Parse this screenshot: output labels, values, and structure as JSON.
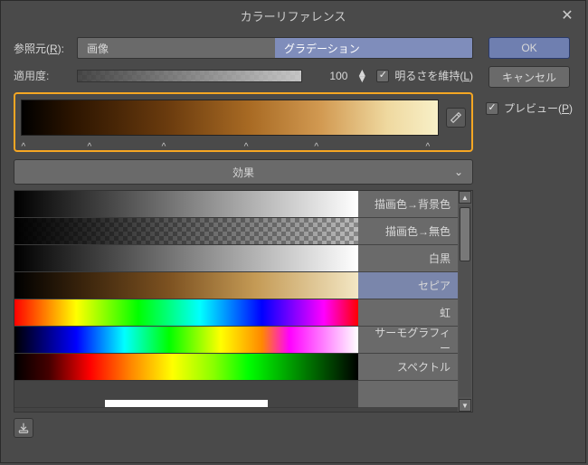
{
  "title": "カラーリファレンス",
  "labels": {
    "source": "参照元(R):",
    "source_u": "R",
    "apply": "適用度:",
    "brightness": "明るさを維持(L)",
    "brightness_u": "L",
    "preview": "プレビュー(P)",
    "preview_u": "P"
  },
  "source_tabs": {
    "image": "画像",
    "gradient": "グラデーション"
  },
  "apply_value": "100",
  "buttons": {
    "ok": "OK",
    "cancel": "キャンセル"
  },
  "effect_label": "効果",
  "presets": [
    {
      "name": "描画色→背景色",
      "gradient": "linear-gradient(to right,#000,#fff)"
    },
    {
      "name": "描画色→無色",
      "gradient": "linear-gradient(to right,#000,rgba(0,0,0,0)),repeating-conic-gradient(#bbb 0% 25%, #888 0% 50%) 0 0/10px 10px"
    },
    {
      "name": "白黒",
      "gradient": "linear-gradient(to right,#000,#fff)"
    },
    {
      "name": "セピア",
      "gradient": "linear-gradient(to right,#000 0%,#3a240c 20%,#7d5221 45%,#c49a55 70%,#f3e7c4 100%)",
      "selected": true
    },
    {
      "name": "虹",
      "gradient": "linear-gradient(to right,#ff0000,#ffff00 18%,#00ff00 36%,#00ffff 54%,#0000ff 72%,#ff00ff 90%,#ff0000 100%)"
    },
    {
      "name": "サーモグラフィー",
      "gradient": "linear-gradient(to right,#000 0%,#00f 18%,#0ff 32%,#0f0 45%,#ff0 60%,#f80 72%,#f0f 80%,#fff 100%)"
    },
    {
      "name": "スペクトル",
      "gradient": "linear-gradient(to right,#000 0%,#400 10%,#f00 22%,#f80 34%,#ff0 46%,#8f0 58%,#0f0 68%,#000 100%)"
    },
    {
      "name": "",
      "gradient": "",
      "partial": true,
      "pg": "linear-gradient(to right,#fff,#fff)"
    }
  ],
  "tick_positions": [
    1,
    17,
    35,
    55,
    72,
    99
  ]
}
